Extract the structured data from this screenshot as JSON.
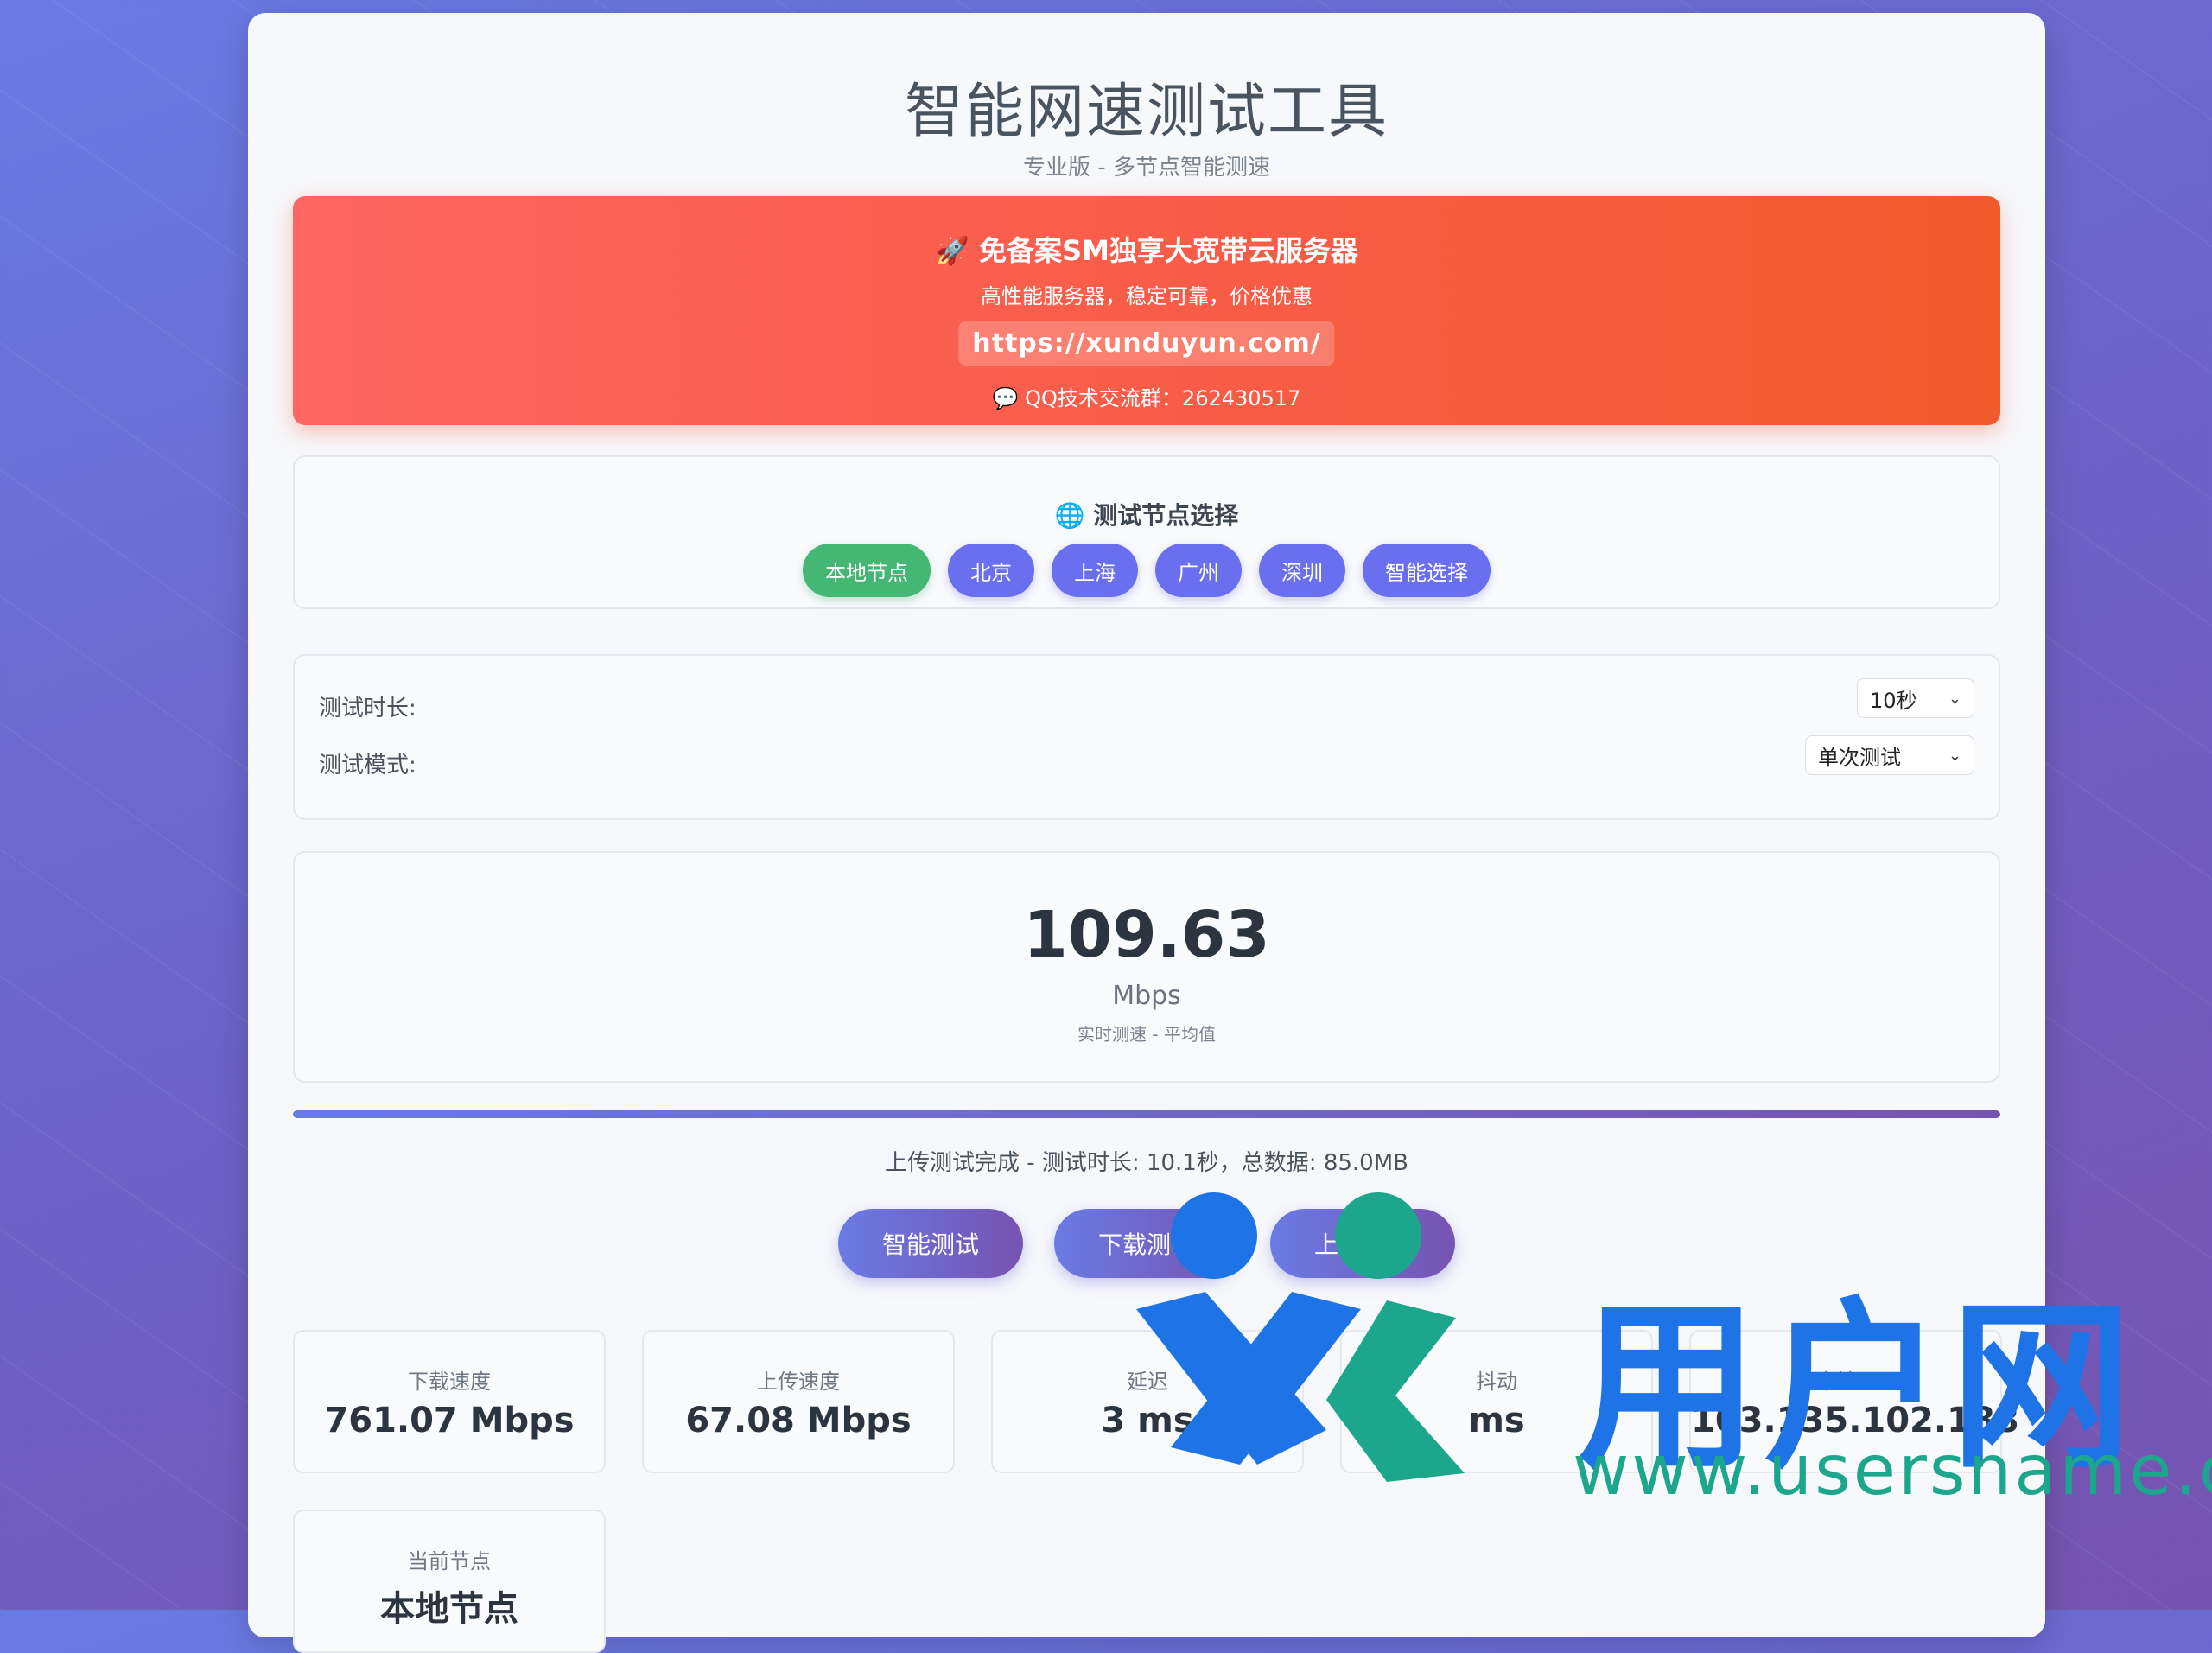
{
  "header": {
    "title": "智能网速测试工具",
    "subtitle": "专业版 - 多节点智能测速"
  },
  "promo": {
    "title": "🚀 免备案SM独享大宽带云服务器",
    "description": "高性能服务器，稳定可靠，价格优惠",
    "link": "https://xunduyun.com/",
    "qq": "💬 QQ技术交流群：262430517"
  },
  "nodes": {
    "title": "🌐 测试节点选择",
    "items": [
      "本地节点",
      "北京",
      "上海",
      "广州",
      "深圳",
      "智能选择"
    ],
    "active": "本地节点"
  },
  "settings": {
    "duration_label": "测试时长:",
    "duration_value": "10秒",
    "mode_label": "测试模式:",
    "mode_value": "单次测试"
  },
  "speed": {
    "value": "109.63",
    "unit": "Mbps",
    "note": "实时测速 - 平均值"
  },
  "progress": {
    "percent": 100
  },
  "status": "上传测试完成 - 测试时长: 10.1秒，总数据: 85.0MB",
  "actions": [
    "智能测试",
    "下载测试",
    "上传测试"
  ],
  "stats": [
    {
      "label": "下载速度",
      "value": "761.07 Mbps"
    },
    {
      "label": "上传速度",
      "value": "67.08 Mbps"
    },
    {
      "label": "延迟",
      "value": "3 ms"
    },
    {
      "label": "抖动",
      "value": "ms"
    },
    {
      "label": "本地IP",
      "value": "103.135.102.188"
    },
    {
      "label": "当前节点",
      "value": "本地节点"
    }
  ],
  "watermark": {
    "logo_text": "用户网",
    "url": "www.usersname.cn"
  },
  "colors": {
    "accent": "#6a6ff0",
    "active_node": "#45b775",
    "promo": "#f85c47"
  }
}
